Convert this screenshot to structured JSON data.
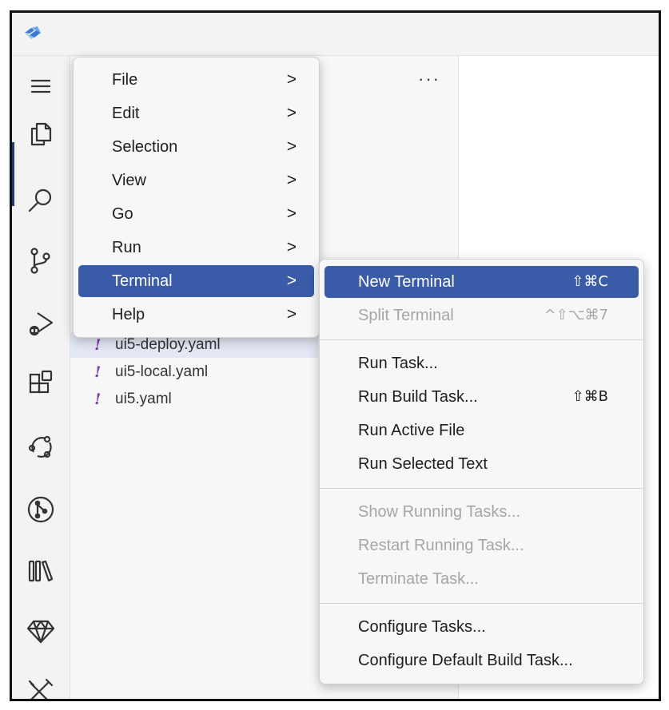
{
  "app": {
    "logo_icon": "app-logo-icon"
  },
  "activity_bar": [
    {
      "name": "menu-hamburger-icon"
    },
    {
      "name": "explorer-icon"
    },
    {
      "name": "search-icon"
    },
    {
      "name": "source-control-icon"
    },
    {
      "name": "run-debug-icon"
    },
    {
      "name": "extensions-icon"
    },
    {
      "name": "remote-icon"
    },
    {
      "name": "git-graph-icon"
    },
    {
      "name": "library-icon"
    },
    {
      "name": "gem-icon"
    },
    {
      "name": "tools-icon"
    }
  ],
  "sidebar": {
    "more_label": "···",
    "files": [
      {
        "label": "ui5-deploy.yaml",
        "marker": "!",
        "selected": true
      },
      {
        "label": "ui5-local.yaml",
        "marker": "!",
        "selected": false
      },
      {
        "label": "ui5.yaml",
        "marker": "!",
        "selected": false
      }
    ]
  },
  "main_menu": {
    "items": [
      {
        "label": "File",
        "arrow": ">"
      },
      {
        "label": "Edit",
        "arrow": ">"
      },
      {
        "label": "Selection",
        "arrow": ">"
      },
      {
        "label": "View",
        "arrow": ">"
      },
      {
        "label": "Go",
        "arrow": ">"
      },
      {
        "label": "Run",
        "arrow": ">"
      },
      {
        "label": "Terminal",
        "arrow": ">",
        "highlighted": true
      },
      {
        "label": "Help",
        "arrow": ">"
      }
    ]
  },
  "terminal_menu": {
    "items": [
      {
        "label": "New Terminal",
        "shortcut": "⇧⌘C",
        "highlighted": true
      },
      {
        "label": "Split Terminal",
        "shortcut": "^⇧⌥⌘7",
        "disabled": true
      },
      {
        "label": "Run Task...",
        "shortcut": ""
      },
      {
        "label": "Run Build Task...",
        "shortcut": "⇧⌘B"
      },
      {
        "label": "Run Active File",
        "shortcut": ""
      },
      {
        "label": "Run Selected Text",
        "shortcut": ""
      },
      {
        "label": "Show Running Tasks...",
        "disabled": true
      },
      {
        "label": "Restart Running Task...",
        "disabled": true
      },
      {
        "label": "Terminate Task...",
        "disabled": true
      },
      {
        "label": "Configure Tasks...",
        "shortcut": ""
      },
      {
        "label": "Configure Default Build Task...",
        "shortcut": ""
      }
    ]
  },
  "colors": {
    "highlight": "#3a5ca8",
    "disabled_text": "#a6a6a6",
    "yaml_marker": "#7a3fb0"
  }
}
